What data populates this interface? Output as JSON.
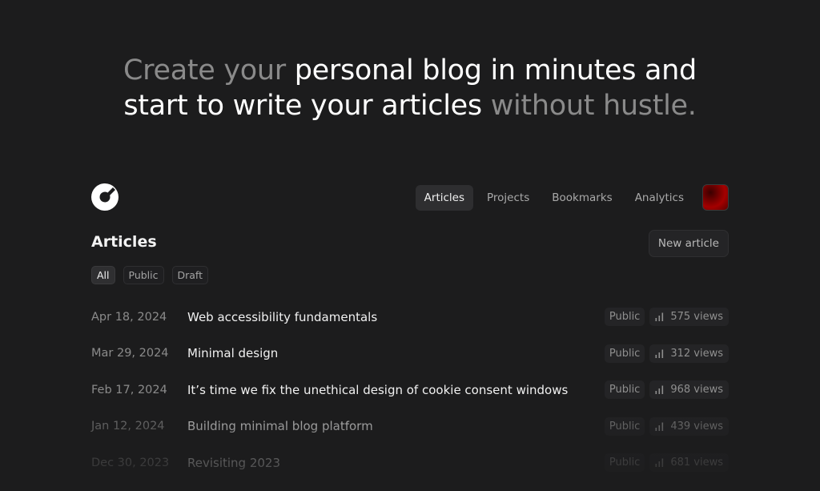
{
  "hero": {
    "part1": "Create your",
    "part2": "personal blog in minutes and",
    "part3": "start to write your articles",
    "part4": "without hustle."
  },
  "nav": {
    "items": [
      {
        "label": "Articles",
        "active": true
      },
      {
        "label": "Projects",
        "active": false
      },
      {
        "label": "Bookmarks",
        "active": false
      },
      {
        "label": "Analytics",
        "active": false
      }
    ]
  },
  "page": {
    "title": "Articles",
    "new_article_label": "New article"
  },
  "filters": [
    {
      "label": "All",
      "active": true
    },
    {
      "label": "Public",
      "active": false
    },
    {
      "label": "Draft",
      "active": false
    }
  ],
  "articles": [
    {
      "date": "Apr 18, 2024",
      "title": "Web accessibility fundamentals",
      "status": "Public",
      "views": "575 views"
    },
    {
      "date": "Mar 29, 2024",
      "title": "Minimal design",
      "status": "Public",
      "views": "312 views"
    },
    {
      "date": "Feb 17, 2024",
      "title": "It’s time we fix the unethical design of cookie consent windows",
      "status": "Public",
      "views": "968 views"
    },
    {
      "date": "Jan 12, 2024",
      "title": "Building minimal blog platform",
      "status": "Public",
      "views": "439 views"
    },
    {
      "date": "Dec 30, 2023",
      "title": "Revisiting 2023",
      "status": "Public",
      "views": "681 views"
    }
  ],
  "colors": {
    "background": "#1c1c1d",
    "muted_text": "#8a8a8a",
    "avatar_accent": "#a40000"
  },
  "icons": {
    "logo": "gauge-logo-icon",
    "views": "bar-chart-icon"
  }
}
